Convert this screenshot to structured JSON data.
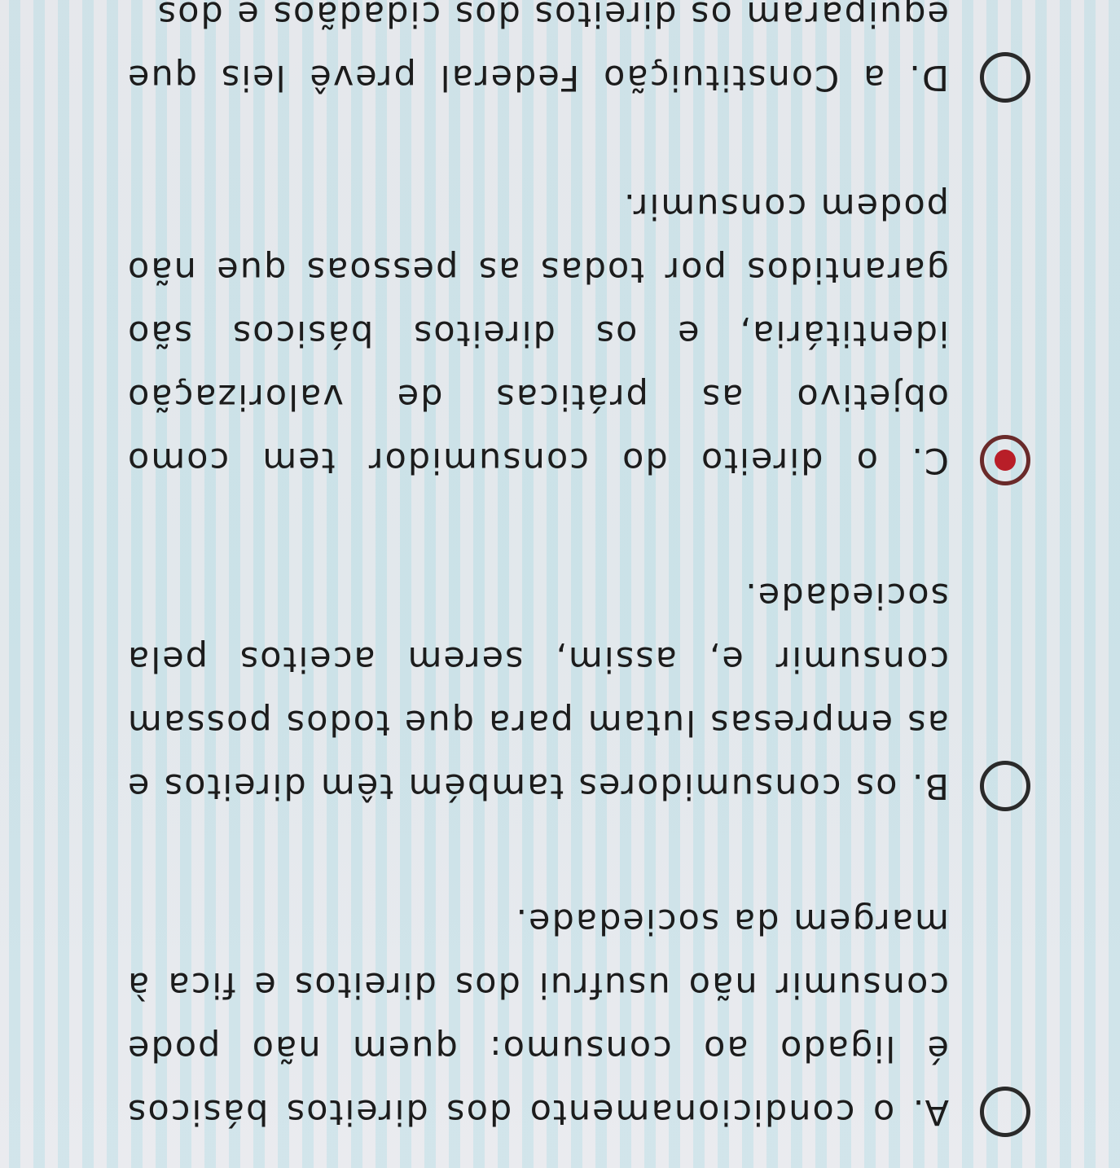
{
  "question": {
    "selected": "C",
    "options": [
      {
        "letter": "A",
        "label": "A. o condicionamento dos direitos básicos é ligado ao consumo: quem não pode consumir não usufrui dos direitos e fica à margem da sociedade.",
        "checked": false
      },
      {
        "letter": "B",
        "label": "B. os consumidores também têm direitos e as empresas lutam para que todos possam consumir e, assim, serem aceitos pela sociedade.",
        "checked": false
      },
      {
        "letter": "C",
        "label": "C. o direito do consumidor tem como objetivo as práticas de valorização identitária, e os direitos básicos são garantidos por todas as pessoas que não podem consumir.",
        "checked": true
      },
      {
        "letter": "D",
        "label": "D. a Constituição Federal prevê leis que equiparam os direitos dos cidadãos e dos",
        "checked": false
      }
    ]
  },
  "colors": {
    "selected_dot": "#b81e28",
    "radio_border": "#2a2a2a"
  },
  "icons": {
    "radio_unchecked": "radio-button-unchecked-icon",
    "radio_checked": "radio-button-checked-icon"
  }
}
